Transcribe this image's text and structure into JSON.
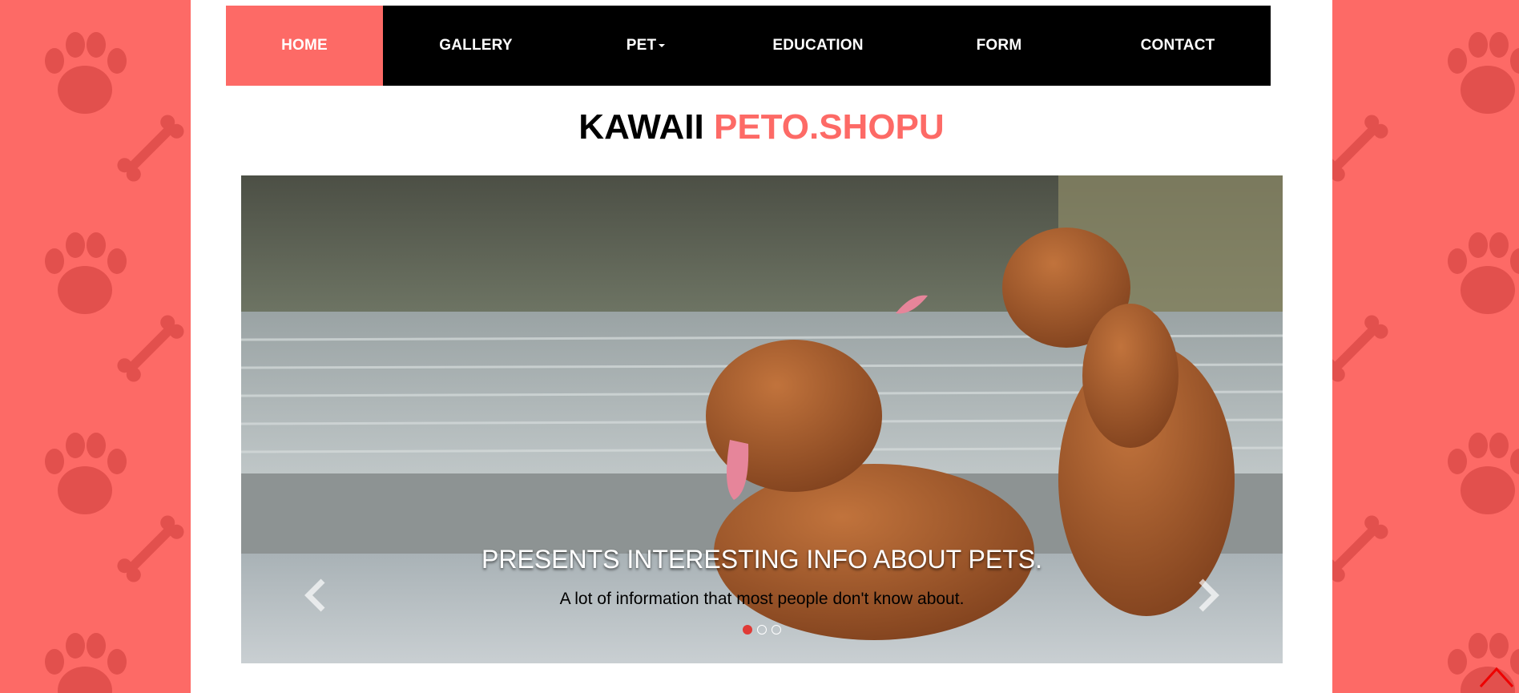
{
  "nav": {
    "items": [
      {
        "label": "HOME",
        "active": true
      },
      {
        "label": "GALLERY",
        "active": false
      },
      {
        "label": "PET",
        "active": false,
        "dropdown": true
      },
      {
        "label": "EDUCATION",
        "active": false
      },
      {
        "label": "FORM",
        "active": false
      },
      {
        "label": "CONTACT",
        "active": false
      }
    ]
  },
  "site_title": {
    "part1": "KAWAII",
    "part2": "PETO.SHOPU"
  },
  "carousel": {
    "heading": "PRESENTS INTERESTING INFO ABOUT PETS.",
    "text": "A lot of information that most people don't know about.",
    "slides_count": 3,
    "active_slide": 1,
    "prev_icon": "chevron-left-icon",
    "next_icon": "chevron-right-icon"
  },
  "scroll_top_icon": "chevron-up-icon",
  "colors": {
    "accent": "#fd6a66",
    "nav_bg": "#000000",
    "paw": "#e2504d"
  }
}
